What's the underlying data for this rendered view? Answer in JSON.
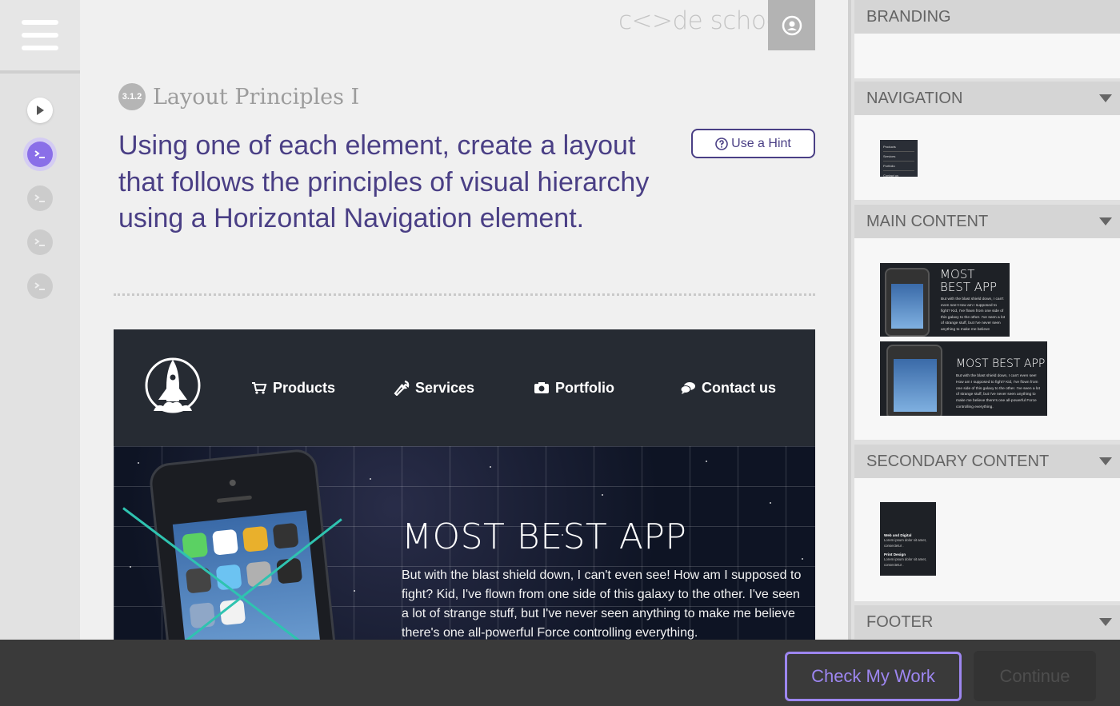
{
  "sidebar": {
    "steps": [
      "play",
      "terminal",
      "terminal",
      "terminal",
      "terminal"
    ]
  },
  "header": {
    "logo": "c<>de school"
  },
  "level": {
    "badge": "3.1.2",
    "title": "Layout Principles I"
  },
  "challenge": {
    "text": "Using one of each element, create a layout that follows the principles of visual hierarchy using a Horizontal Navigation element.",
    "hint_label": "Use a Hint"
  },
  "preview": {
    "nav": {
      "links": [
        {
          "label": "Products",
          "icon": "cart-icon"
        },
        {
          "label": "Services",
          "icon": "wrench-icon"
        },
        {
          "label": "Portfolio",
          "icon": "camera-icon"
        },
        {
          "label": "Contact us",
          "icon": "chat-icon"
        }
      ]
    },
    "hero": {
      "title": "MOST BEST APP",
      "text": "But with the blast shield down, I can't even see! How am I supposed to fight? Kid, I've flown from one side of this galaxy to the other. I've seen a lot of strange stuff, but I've never seen anything to make me believe there's one all-powerful Force controlling everything."
    }
  },
  "panel": {
    "sections": [
      {
        "title": "BRANDING",
        "collapsible": false
      },
      {
        "title": "NAVIGATION",
        "collapsible": true
      },
      {
        "title": "MAIN CONTENT",
        "collapsible": true
      },
      {
        "title": "SECONDARY CONTENT",
        "collapsible": true
      },
      {
        "title": "FOOTER",
        "collapsible": true
      }
    ],
    "nav_thumb_items": [
      "Products",
      "Services",
      "Portfolio",
      "Contact us"
    ],
    "main_thumbs": [
      {
        "title": "MOST BEST APP",
        "text": "But with the blast shield down, I can't even see! How am I supposed to fight? Kid, I've flown from one side of this galaxy to the other. I've seen a lot of strange stuff, but I've never seen anything to make me believe"
      },
      {
        "title": "MOST BEST APP",
        "text": "But with the blast shield down, I can't even see! How am I supposed to fight? Kid, I've flown from one side of this galaxy to the other. I've seen a lot of strange stuff, but I've never seen anything to make me believe there's one all-powerful Force controlling everything."
      }
    ],
    "secondary_thumb": {
      "h1": "Web and Digital",
      "t1": "Lorem ipsum dolor sit amet, consectetur .",
      "h2": "Print Design",
      "t2": "Lorem ipsum dolor sit amet, consectetur ."
    }
  },
  "footer": {
    "check_label": "Check My Work",
    "continue_label": "Continue"
  },
  "colors": {
    "accent": "#9d86f0",
    "title": "#4a3f85",
    "active_step": "#8a6fe8",
    "teal": "#2fc3b0"
  }
}
